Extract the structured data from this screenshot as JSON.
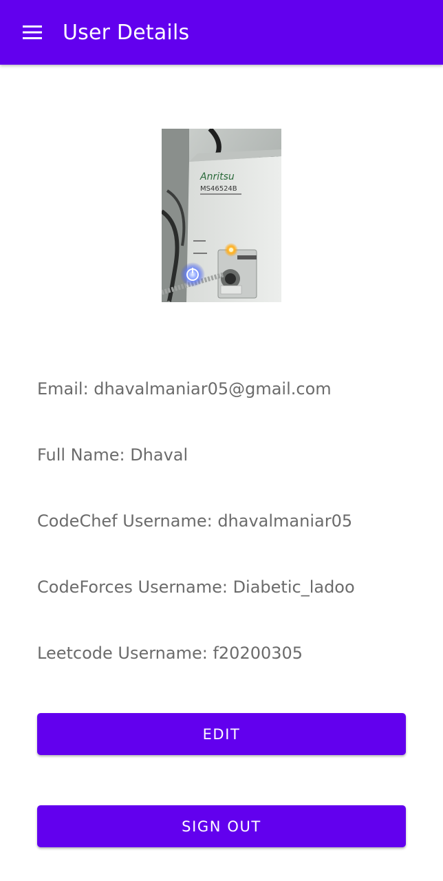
{
  "app_bar": {
    "title": "User Details",
    "menu_icon": "hamburger-menu-icon",
    "background_color": "#6200ee"
  },
  "profile": {
    "photo_icon": "profile-photo",
    "photo_device_brand": "Anritsu",
    "photo_device_model": "MS46524B"
  },
  "details": {
    "email": "Email: dhavalmaniar05@gmail.com",
    "full_name": "Full Name: Dhaval",
    "codechef": "CodeChef Username: dhavalmaniar05",
    "codeforces": "CodeForces Username: Diabetic_ladoo",
    "leetcode": "Leetcode Username: f20200305"
  },
  "buttons": {
    "edit_label": "EDIT",
    "sign_out_label": "SIGN OUT",
    "color": "#6200ee"
  }
}
